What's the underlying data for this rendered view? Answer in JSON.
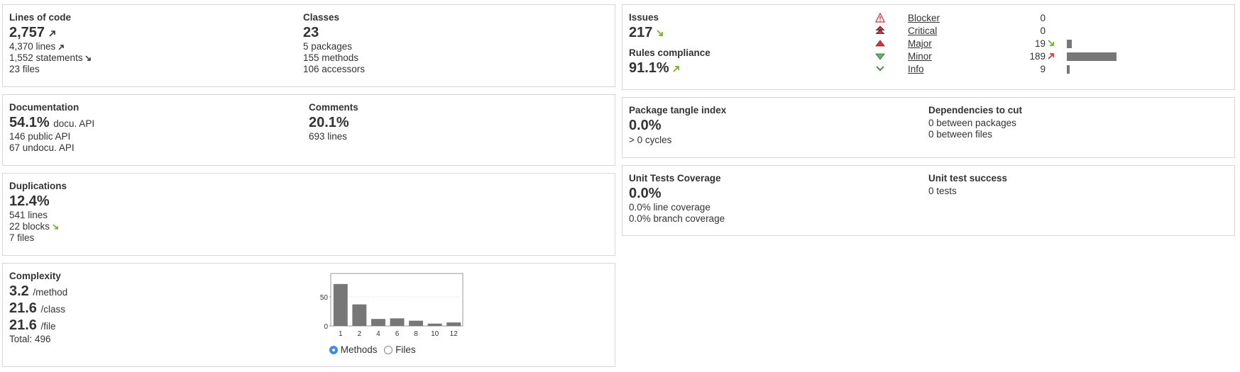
{
  "loc": {
    "title": "Lines of code",
    "value": "2,757",
    "lines": "4,370 lines",
    "statements": "1,552 statements",
    "files": "23 files"
  },
  "classes": {
    "title": "Classes",
    "value": "23",
    "packages": "5 packages",
    "methods": "155 methods",
    "accessors": "106 accessors"
  },
  "documentation": {
    "title": "Documentation",
    "value": "54.1%",
    "unit": "docu. API",
    "public_api": "146 public API",
    "undoc_api": "67 undocu. API"
  },
  "comments": {
    "title": "Comments",
    "value": "20.1%",
    "lines": "693 lines"
  },
  "duplications": {
    "title": "Duplications",
    "value": "12.4%",
    "lines": "541 lines",
    "blocks": "22 blocks",
    "files": "7 files"
  },
  "complexity": {
    "title": "Complexity",
    "per_method": "3.2",
    "per_method_unit": "/method",
    "per_class": "21.6",
    "per_class_unit": "/class",
    "per_file": "21.6",
    "per_file_unit": "/file",
    "total": "Total: 496",
    "radio_methods": "Methods",
    "radio_files": "Files",
    "selected": "Methods"
  },
  "chart_data": {
    "type": "bar",
    "categories": [
      "1",
      "2",
      "4",
      "6",
      "8",
      "10",
      "12"
    ],
    "values": [
      72,
      37,
      12,
      13,
      9,
      4,
      6
    ],
    "ylim": [
      0,
      90
    ],
    "yticks": [
      0,
      50
    ],
    "bar_color": "#777777"
  },
  "issues": {
    "title": "Issues",
    "value": "217",
    "compliance_title": "Rules compliance",
    "compliance_value": "91.1%",
    "severities": [
      {
        "label": "Blocker",
        "count": "0",
        "icon": "blocker-icon",
        "bar_fraction": 0
      },
      {
        "label": "Critical",
        "count": "0",
        "icon": "critical-icon",
        "bar_fraction": 0
      },
      {
        "label": "Major",
        "count": "19",
        "icon": "major-icon",
        "bar_fraction": 0.1,
        "trend": "down-good"
      },
      {
        "label": "Minor",
        "count": "189",
        "icon": "minor-icon",
        "bar_fraction": 1.0,
        "trend": "up-bad"
      },
      {
        "label": "Info",
        "count": "9",
        "icon": "info-icon",
        "bar_fraction": 0.05
      }
    ]
  },
  "tangle": {
    "title": "Package tangle index",
    "value": "0.0%",
    "cycles": "> 0 cycles"
  },
  "dependencies": {
    "title": "Dependencies to cut",
    "packages": "0 between packages",
    "files": "0 between files"
  },
  "coverage": {
    "title": "Unit Tests Coverage",
    "value": "0.0%",
    "line_cov": "0.0% line coverage",
    "branch_cov": "0.0% branch coverage"
  },
  "test_success": {
    "title": "Unit test success",
    "tests": "0 tests"
  },
  "colors": {
    "trend_good": "#6cb41f",
    "trend_bad": "#d4333f",
    "trend_neutral": "#333333"
  }
}
